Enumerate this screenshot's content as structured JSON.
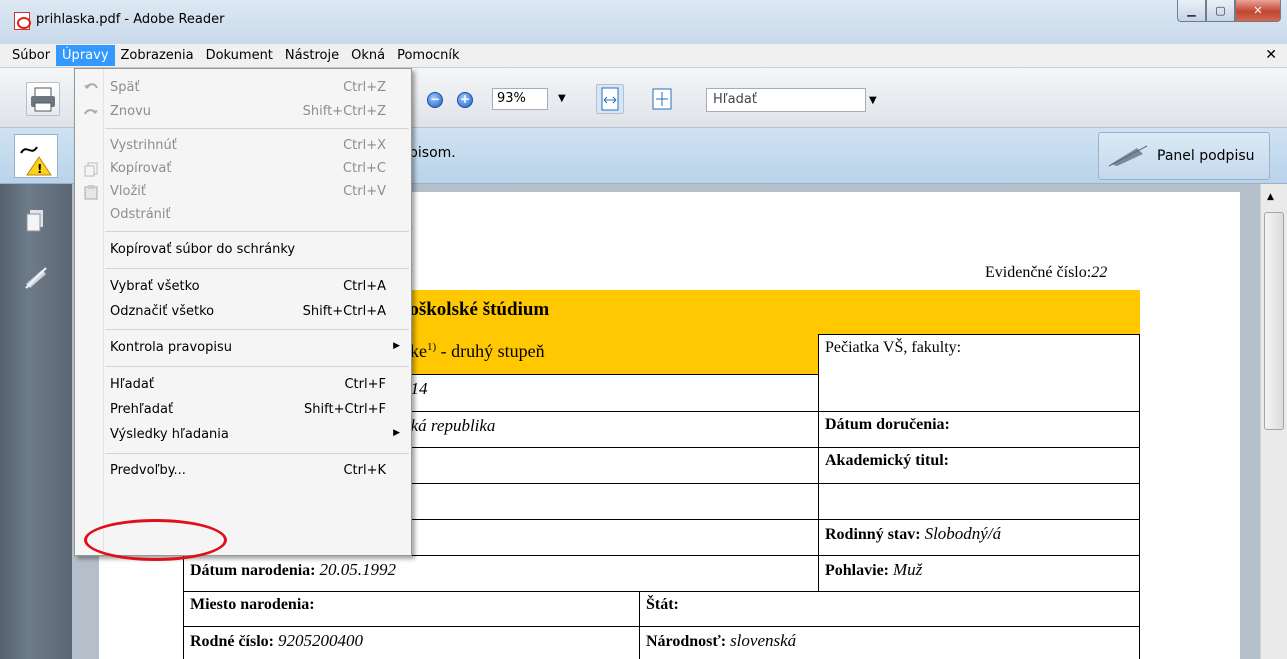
{
  "window": {
    "title": "prihlaska.pdf - Adobe Reader",
    "icon": "pdf-icon"
  },
  "menubar": {
    "items": [
      "Súbor",
      "Úpravy",
      "Zobrazenia",
      "Dokument",
      "Nástroje",
      "Okná",
      "Pomocník"
    ],
    "active": "Úpravy"
  },
  "toolbar": {
    "zoom": "93%",
    "find_placeholder": "Hľadať"
  },
  "signbar": {
    "text_fragment": "pisom.",
    "panel_button": "Panel podpisu"
  },
  "edit_menu": {
    "items": [
      {
        "label": "Späť",
        "shortcut": "Ctrl+Z",
        "disabled": true,
        "icon": "undo-icon"
      },
      {
        "label": "Znovu",
        "shortcut": "Shift+Ctrl+Z",
        "disabled": true,
        "icon": "redo-icon"
      },
      {
        "label": "Vystrihnúť",
        "shortcut": "Ctrl+X",
        "disabled": true
      },
      {
        "label": "Kopírovať",
        "shortcut": "Ctrl+C",
        "disabled": true,
        "icon": "copy-icon"
      },
      {
        "label": "Vložiť",
        "shortcut": "Ctrl+V",
        "disabled": true,
        "icon": "paste-icon"
      },
      {
        "label": "Odstrániť",
        "shortcut": "",
        "disabled": true
      },
      {
        "label": "Kopírovať súbor do schránky",
        "shortcut": "",
        "disabled": false
      },
      {
        "label": "Vybrať všetko",
        "shortcut": "Ctrl+A",
        "disabled": false
      },
      {
        "label": "Odznačiť všetko",
        "shortcut": "Shift+Ctrl+A",
        "disabled": false
      },
      {
        "label": "Kontrola pravopisu",
        "shortcut": "",
        "disabled": false,
        "submenu": true
      },
      {
        "label": "Hľadať",
        "shortcut": "Ctrl+F",
        "disabled": false
      },
      {
        "label": "Prehľadať",
        "shortcut": "Shift+Ctrl+F",
        "disabled": false
      },
      {
        "label": "Výsledky hľadania",
        "shortcut": "",
        "disabled": false,
        "submenu": true
      },
      {
        "label": "Predvoľby...",
        "shortcut": "Ctrl+K",
        "disabled": false,
        "highlighted_by_circle": true
      }
    ]
  },
  "document": {
    "evidencne_cislo_label": "Evidenčné číslo:",
    "evidencne_cislo_value": "22",
    "title_fragment": "toškolské štúdium",
    "subtitle_fragment": "ske",
    "subtitle_sup": "1)",
    "subtitle_rest": " - druhý stupeň",
    "year_fragment": "014",
    "country_fragment": "ská republika",
    "peciatka_label": "Pečiatka VŠ, fakulty:",
    "datum_dorucenia_label": "Dátum doručenia:",
    "akademicky_titul_label": "Akademický titul:",
    "rodinny_stav_label": "Rodinný stav:",
    "rodinny_stav_value": "Slobodný/á",
    "datum_narodenia_label": "Dátum narodenia:",
    "datum_narodenia_value": "20.05.1992",
    "pohlavie_label": "Pohlavie:",
    "pohlavie_value": "Muž",
    "miesto_narodenia_label": "Miesto narodenia:",
    "stat_label": "Štát:",
    "rodne_cislo_label": "Rodné číslo:",
    "rodne_cislo_value": "9205200400",
    "narodnost_label": "Národnosť:",
    "narodnost_value": "slovenská"
  }
}
